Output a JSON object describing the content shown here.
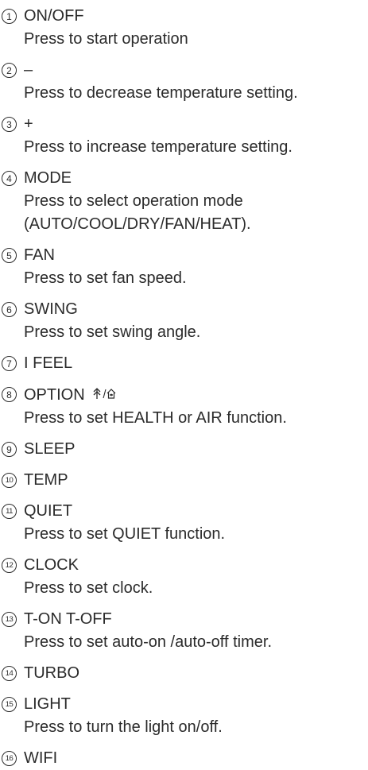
{
  "items": [
    {
      "num": "1",
      "title": "ON/OFF",
      "desc": [
        "Press to start operation"
      ]
    },
    {
      "num": "2",
      "title": "–",
      "desc": [
        "Press to decrease temperature setting."
      ]
    },
    {
      "num": "3",
      "title": "+",
      "desc": [
        "Press to increase temperature setting."
      ]
    },
    {
      "num": "4",
      "title": "MODE",
      "desc": [
        "Press to select operation mode",
        "(AUTO/COOL/DRY/FAN/HEAT)."
      ]
    },
    {
      "num": "5",
      "title": "FAN",
      "desc": [
        "Press to set fan speed."
      ]
    },
    {
      "num": "6",
      "title": "SWING",
      "desc": [
        "Press to set swing angle."
      ]
    },
    {
      "num": "7",
      "title": "I FEEL",
      "desc": []
    },
    {
      "num": "8",
      "title": "OPTION",
      "title_icon": "health-air-icons",
      "desc": [
        "Press to set HEALTH or AIR function."
      ]
    },
    {
      "num": "9",
      "title": "SLEEP",
      "desc": []
    },
    {
      "num": "10",
      "title": "TEMP",
      "desc": []
    },
    {
      "num": "11",
      "title": "QUIET",
      "desc": [
        "Press to set QUIET function."
      ]
    },
    {
      "num": "12",
      "title": "CLOCK",
      "desc": [
        "Press to set clock."
      ]
    },
    {
      "num": "13",
      "title": "T-ON T-OFF",
      "desc": [
        "Press to set auto-on /auto-off timer."
      ]
    },
    {
      "num": "14",
      "title": "TURBO",
      "desc": []
    },
    {
      "num": "15",
      "title": "LIGHT",
      "desc": [
        "Press to turn the light on/off."
      ]
    },
    {
      "num": "16",
      "title": "WIFI",
      "desc": []
    }
  ],
  "text_color": "#2b2b2b"
}
